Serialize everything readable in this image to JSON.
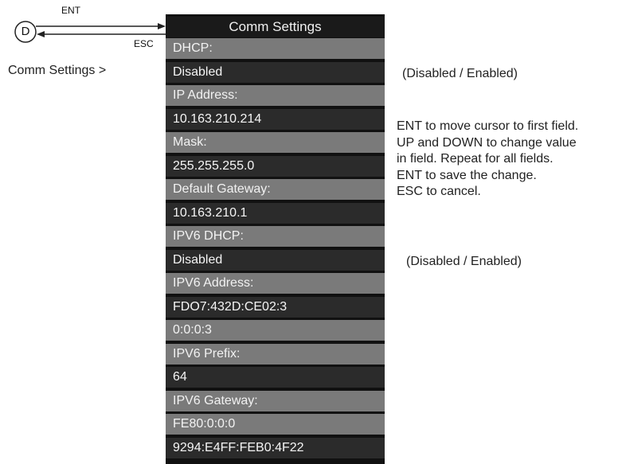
{
  "nav": {
    "key_button": "D",
    "ent_label": "ENT",
    "esc_label": "ESC",
    "menu_path": "Comm Settings >"
  },
  "screen": {
    "title": "Comm Settings",
    "rows": [
      {
        "text": "DHCP:",
        "kind": "label"
      },
      {
        "text": "Disabled",
        "kind": "value"
      },
      {
        "text": "IP Address:",
        "kind": "label"
      },
      {
        "text": "10.163.210.214",
        "kind": "value"
      },
      {
        "text": "Mask:",
        "kind": "label"
      },
      {
        "text": "255.255.255.0",
        "kind": "value"
      },
      {
        "text": "Default Gateway:",
        "kind": "label"
      },
      {
        "text": "10.163.210.1",
        "kind": "value"
      },
      {
        "text": "IPV6 DHCP:",
        "kind": "label"
      },
      {
        "text": "Disabled",
        "kind": "value"
      },
      {
        "text": "IPV6 Address:",
        "kind": "label"
      },
      {
        "text": "FDO7:432D:CE02:3",
        "kind": "value"
      },
      {
        "text": "0:0:0:3",
        "kind": "cont"
      },
      {
        "text": "IPV6 Prefix:",
        "kind": "label"
      },
      {
        "text": "64",
        "kind": "value"
      },
      {
        "text": "IPV6 Gateway:",
        "kind": "label"
      },
      {
        "text": "FE80:0:0:0",
        "kind": "cont"
      },
      {
        "text": "9294:E4FF:FEB0:4F22",
        "kind": "value"
      }
    ]
  },
  "notes": {
    "dhcp_options": "(Disabled / Enabled)",
    "ipv6_dhcp_options": "(Disabled / Enabled)",
    "instructions": [
      "ENT to move cursor to first field.",
      "UP and DOWN to change value",
      "in field. Repeat for all fields.",
      "ENT to save the change.",
      "ESC to cancel."
    ]
  }
}
